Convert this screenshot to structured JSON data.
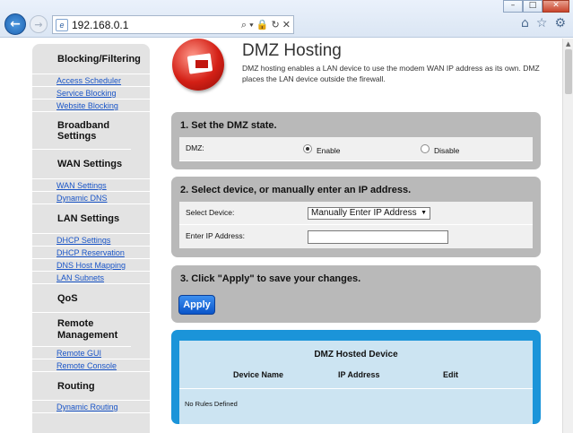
{
  "browser": {
    "url": "192.168.0.1",
    "address_controls": "⌕ ▾ 🔒 ↻ ✕",
    "back_glyph": "←",
    "forward_glyph": "→",
    "home_glyph": "⌂",
    "favorites_glyph": "☆",
    "settings_glyph": "⚙"
  },
  "sidebar": {
    "sections": [
      {
        "heading": "Blocking/Filtering",
        "links": [
          "Access Scheduler",
          "Service Blocking",
          "Website Blocking"
        ]
      },
      {
        "heading": "Broadband Settings",
        "links": []
      },
      {
        "heading": "WAN Settings",
        "links": [
          "WAN Settings",
          "Dynamic DNS"
        ]
      },
      {
        "heading": "LAN Settings",
        "links": [
          "DHCP Settings",
          "DHCP Reservation",
          "DNS Host Mapping",
          "LAN Subnets"
        ]
      },
      {
        "heading": "QoS",
        "links": []
      },
      {
        "heading": "Remote Management",
        "links": [
          "Remote GUI",
          "Remote Console"
        ]
      },
      {
        "heading": "Routing",
        "links": [
          "Dynamic Routing"
        ]
      }
    ]
  },
  "header": {
    "title": "DMZ Hosting",
    "description": "DMZ hosting enables a LAN device to use the modem WAN IP address as its own. DMZ places the LAN device outside the firewall."
  },
  "step1": {
    "title": "1. Set the DMZ state.",
    "label": "DMZ:",
    "enable_label": "Enable",
    "disable_label": "Disable",
    "selected": "Enable"
  },
  "step2": {
    "title": "2. Select device, or manually enter an IP address.",
    "select_label": "Select Device:",
    "select_value": "Manually Enter IP Address",
    "ip_label": "Enter IP Address:",
    "ip_value": ""
  },
  "step3": {
    "title": "3. Click \"Apply\" to save your changes.",
    "apply_label": "Apply"
  },
  "hosted": {
    "title": "DMZ Hosted Device",
    "columns": [
      "Device Name",
      "IP  Address",
      "Edit"
    ],
    "empty_text": "No Rules Defined"
  },
  "colors": {
    "accent": "#1b94d9",
    "panel": "#b9b9b9",
    "link": "#1a55c7",
    "apply": "#0a55c9"
  }
}
